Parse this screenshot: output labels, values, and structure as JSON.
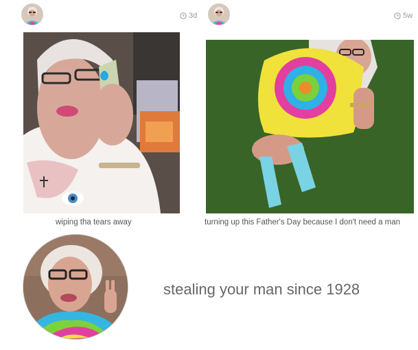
{
  "posts": [
    {
      "time": "3d",
      "caption": "wiping tha tears away",
      "photo": "woman-holding-money-photo"
    },
    {
      "time": "5w",
      "caption": "turning up this Father's Day because I don't need a man",
      "photo": "woman-tie-dye-on-grass-photo"
    }
  ],
  "profile": {
    "bio": "stealing your man since 1928"
  },
  "icons": {
    "clock": "clock-icon"
  },
  "colors": {
    "background": "#ffffff",
    "meta_text": "#9a9a9a",
    "caption_text": "#555555",
    "bio_text": "#666666"
  }
}
